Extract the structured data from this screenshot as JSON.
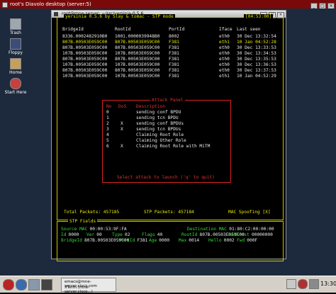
{
  "vnc": {
    "title": "root's Diavolo desktop (server:5)"
  },
  "desktop": {
    "icons": [
      {
        "label": "Trash"
      },
      {
        "label": "Floppy"
      },
      {
        "label": "Home"
      },
      {
        "label": "Start Here"
      }
    ]
  },
  "xterm": {
    "title": "root@mne-server: ~/src/yersinia-0.5.6",
    "app_title": "yersinia 0.5.6 by Slay & tomac - STP mode",
    "clock": "[04:53:00]",
    "table": {
      "headers": [
        "BridgeId",
        "RootId",
        "PortId",
        "Iface",
        "Last seen"
      ],
      "rows": [
        [
          "8336.0002482910B0",
          "1001.0000039948B0",
          "8002",
          "eth0",
          "30 Dec 13:32:54"
        ],
        [
          "807B.00503E059C00",
          "807B.00503E059C00",
          "F381",
          "eth1",
          "10 Jan 04:52:28"
        ],
        [
          "807B.00503E059C00",
          "807B.00503E059C00",
          "F381",
          "eth0",
          "30 Dec 13:33:53"
        ],
        [
          "107B.00503E059C00",
          "107B.00503E059C00",
          "F381",
          "eth0",
          "30 Dec 13:34:53"
        ],
        [
          "807B.00503E059C00",
          "807B.00503E059C00",
          "F381",
          "eth0",
          "30 Dec 13:35:53"
        ],
        [
          "107B.00503E059C00",
          "107B.00503E059C00",
          "F381",
          "eth0",
          "30 Dec 13:36:53"
        ],
        [
          "807B.00503E059C00",
          "807B.00503E059C00",
          "F381",
          "eth0",
          "30 Dec 13:37:53"
        ],
        [
          "107B.00503E059C00",
          "107B.00503E059C00",
          "F381",
          "eth1",
          "10 Jan 04:52:29"
        ]
      ]
    },
    "attack_panel": {
      "title": "Attack Panel",
      "headers": [
        "No",
        "DoS",
        "Description"
      ],
      "items": [
        [
          "0",
          "",
          "sending conf BPDU"
        ],
        [
          "1",
          "",
          "sending tcn BPDU"
        ],
        [
          "2",
          "X",
          "sending conf BPDUs"
        ],
        [
          "3",
          "X",
          "sending tcn BPDUs"
        ],
        [
          "4",
          "",
          "Claiming Root Role"
        ],
        [
          "5",
          "",
          "Claiming Other Role"
        ],
        [
          "6",
          "X",
          "Claiming Root Role with MiTM"
        ]
      ],
      "prompt": "Select attack to launch ('q' to quit)"
    },
    "status": {
      "total_packets": "Total Packets: 457185",
      "stp_packets": "STP Packets: 457184",
      "mac_spoofing": "MAC Spoofing [X]"
    },
    "fields": {
      "title": "STP Fields",
      "line1": [
        {
          "label": "Source MAC",
          "value": "00:00:53:9F:FA"
        },
        {
          "label": "Destination MAC",
          "value": "01:80:C2:00:00:00"
        }
      ],
      "line2": [
        {
          "label": "Id",
          "value": "0000"
        },
        {
          "label": "Ver",
          "value": "00"
        },
        {
          "label": "Type",
          "value": "02"
        },
        {
          "label": "Flags",
          "value": "40"
        },
        {
          "label": "RootId",
          "value": "807B.00503E059C00"
        },
        {
          "label": "Pathcost",
          "value": "00000000"
        }
      ],
      "line3": [
        {
          "label": "BridgeId",
          "value": "807B.00503E059C00"
        },
        {
          "label": "PortId",
          "value": "F381"
        },
        {
          "label": "Age",
          "value": "0000"
        },
        {
          "label": "Max",
          "value": "0014"
        },
        {
          "label": "Hello",
          "value": "0002"
        },
        {
          "label": "Fwd",
          "value": "000F"
        }
      ]
    }
  },
  "taskbar": {
    "task_line1": "emacs@mne-server.cisco.com",
    "task_line2": "XTerm (mne-server.cisco...)",
    "clock": "13:30"
  },
  "colors": {
    "frame": "#c8c800",
    "title_text": "#e8e800",
    "data_text": "#e8e8e8",
    "field_label": "#36d936",
    "attack_border": "#d22222",
    "vnc_bar": "#7a0a0a",
    "desktop_bg": "#1d2a3d"
  }
}
